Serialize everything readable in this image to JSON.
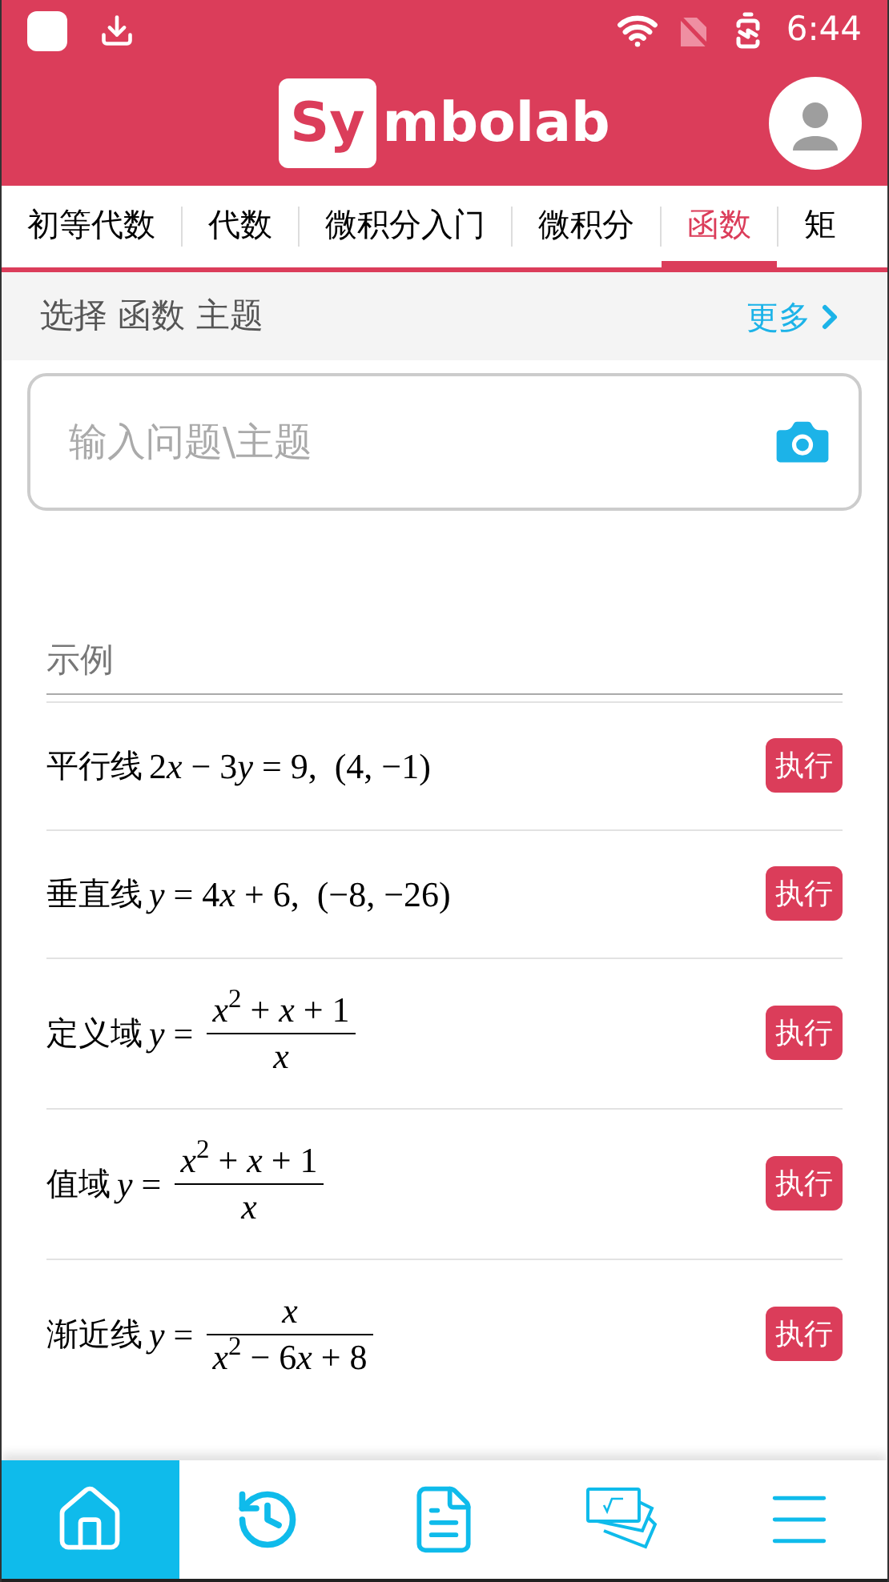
{
  "status_bar": {
    "time": "6:44"
  },
  "header": {
    "logo_box": "Sy",
    "logo_rest": "mbolab"
  },
  "tabs": [
    {
      "label": "初等代数",
      "selected": false
    },
    {
      "label": "代数",
      "selected": false
    },
    {
      "label": "微积分入门",
      "selected": false
    },
    {
      "label": "微积分",
      "selected": false
    },
    {
      "label": "函数",
      "selected": true
    },
    {
      "label": "矩",
      "selected": false
    }
  ],
  "topic_bar": {
    "title": "选择 函数 主题",
    "more": "更多"
  },
  "search": {
    "placeholder": "输入问题\\主题"
  },
  "examples": {
    "heading": "示例",
    "items": [
      {
        "kind": "inline",
        "label": "平行线",
        "math": [
          {
            "kind": "num",
            "text": "2"
          },
          {
            "kind": "var",
            "text": "x"
          },
          {
            "kind": "num",
            "text": " − 3"
          },
          {
            "kind": "var",
            "text": "y"
          },
          {
            "kind": "num",
            "text": " = 9,  (4, −1)"
          }
        ],
        "button": "执行"
      },
      {
        "kind": "inline",
        "label": "垂直线",
        "math": [
          {
            "kind": "var",
            "text": "y"
          },
          {
            "kind": "num",
            "text": " = 4"
          },
          {
            "kind": "var",
            "text": "x"
          },
          {
            "kind": "num",
            "text": " + 6,  (−8, −26)"
          }
        ],
        "button": "执行"
      },
      {
        "kind": "fraction",
        "label": "定义域",
        "lhs": [
          {
            "kind": "var",
            "text": "y"
          },
          {
            "kind": "num",
            "text": " ="
          }
        ],
        "numerator": [
          {
            "kind": "var",
            "text": "x"
          },
          {
            "kind": "num",
            "text": "$^{2}$ + "
          },
          {
            "kind": "var",
            "text": "x"
          },
          {
            "kind": "num",
            "text": " + 1"
          }
        ],
        "denominator": [
          {
            "kind": "var",
            "text": "x"
          }
        ],
        "button": "执行"
      },
      {
        "kind": "fraction",
        "label": "值域",
        "lhs": [
          {
            "kind": "var",
            "text": "y"
          },
          {
            "kind": "num",
            "text": " ="
          }
        ],
        "numerator": [
          {
            "kind": "var",
            "text": "x"
          },
          {
            "kind": "num",
            "text": "$^{2}$ + "
          },
          {
            "kind": "var",
            "text": "x"
          },
          {
            "kind": "num",
            "text": " + 1"
          }
        ],
        "denominator": [
          {
            "kind": "var",
            "text": "x"
          }
        ],
        "button": "执行"
      },
      {
        "kind": "fraction",
        "label": "渐近线",
        "lhs": [
          {
            "kind": "var",
            "text": "y"
          },
          {
            "kind": "num",
            "text": " ="
          }
        ],
        "numerator": [
          {
            "kind": "var",
            "text": "x"
          }
        ],
        "denominator": [
          {
            "kind": "var",
            "text": "x"
          },
          {
            "kind": "num",
            "text": "$^{2}$ − 6"
          },
          {
            "kind": "var",
            "text": "x"
          },
          {
            "kind": "num",
            "text": " + 8"
          }
        ],
        "button": "执行"
      }
    ]
  },
  "bottom_nav": [
    {
      "kind": "home",
      "selected": true
    },
    {
      "kind": "history",
      "selected": false
    },
    {
      "kind": "notes",
      "selected": false
    },
    {
      "kind": "practice",
      "selected": false
    },
    {
      "kind": "menu",
      "selected": false
    }
  ]
}
